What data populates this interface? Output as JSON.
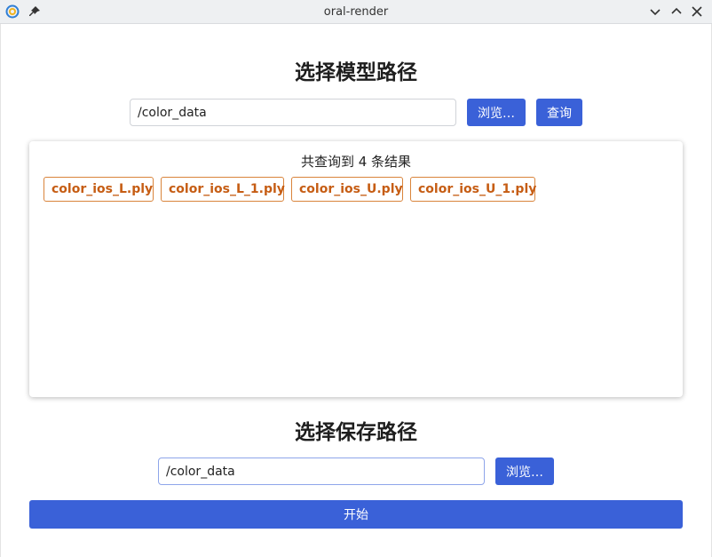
{
  "window": {
    "title": "oral-render",
    "icons": {
      "app": "app-logo-icon",
      "pin": "pin-icon",
      "minimize": "chevron-down-icon",
      "maximize": "chevron-up-icon",
      "close": "close-icon"
    }
  },
  "model_section": {
    "title": "选择模型路径",
    "path_value": "/color_data",
    "browse_label": "浏览…",
    "query_label": "查询"
  },
  "results": {
    "count_text": "共查询到 4 条结果",
    "files": [
      "color_ios_L.ply",
      "color_ios_L_1.ply",
      "color_ios_U.ply",
      "color_ios_U_1.ply"
    ]
  },
  "save_section": {
    "title": "选择保存路径",
    "path_value": "/color_data",
    "browse_label": "浏览…"
  },
  "start_label": "开始",
  "colors": {
    "accent": "#3a61d8",
    "tag_text": "#c65d14",
    "tag_border": "#d9843b"
  }
}
